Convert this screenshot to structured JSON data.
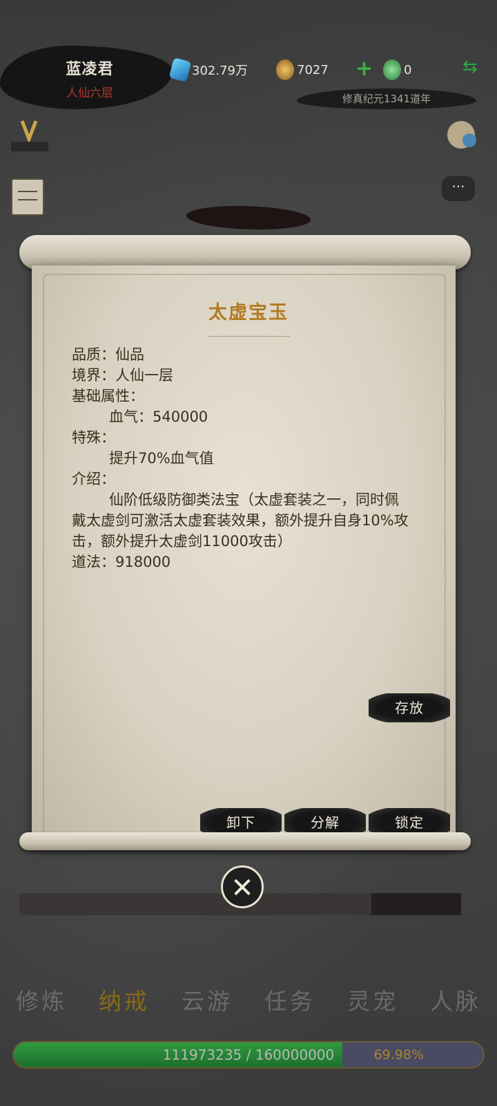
{
  "player": {
    "name": "蓝凌君",
    "rank": "人仙六层"
  },
  "resources": {
    "spirit_stone": "302.79万",
    "gold": "7027",
    "jade": "0"
  },
  "era": "修真纪元1341道年",
  "item": {
    "title": "太虚宝玉",
    "quality_label": "品质：",
    "quality": "仙品",
    "realm_label": "境界：",
    "realm": "人仙一层",
    "base_attr_label": "基础属性：",
    "base_attr": "血气：540000",
    "special_label": "特殊：",
    "special": "提升70%血气值",
    "intro_label": "介绍：",
    "intro": "仙阶低级防御类法宝（太虚套装之一，同时佩戴太虚剑可激活太虚套装效果，额外提升自身10%攻击，额外提升太虚剑11000攻击）",
    "dao_label": "道法：",
    "dao": "918000"
  },
  "buttons": {
    "store": "存放",
    "unequip": "卸下",
    "decompose": "分解",
    "lock": "锁定",
    "close": "✕"
  },
  "nav": [
    "修炼",
    "纳戒",
    "云游",
    "任务",
    "灵宠",
    "人脉"
  ],
  "nav_active": 1,
  "exp": {
    "text": "111973235 / 160000000",
    "percent": "69.98%",
    "fill_fraction": 0.6998
  },
  "colors": {
    "title": "#b27b23",
    "text": "#3b2e1f",
    "exp_fill": "#2e9a3f"
  }
}
